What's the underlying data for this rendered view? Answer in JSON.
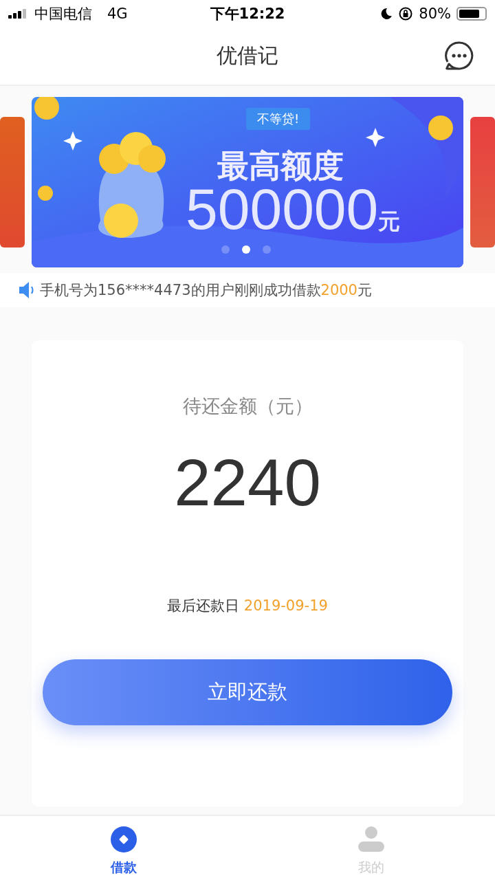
{
  "status_bar": {
    "carrier": "中国电信",
    "network": "4G",
    "time": "下午12:22",
    "battery": "80%"
  },
  "nav": {
    "title": "优借记"
  },
  "banner": {
    "tag": "不等贷!",
    "headline": "最高额度",
    "amount": "500000",
    "unit": "元",
    "dots": [
      {
        "selected": false
      },
      {
        "selected": true
      },
      {
        "selected": false
      }
    ]
  },
  "notice": {
    "text": "手机号为156****4473的用户刚刚成功借款",
    "amount": "2000",
    "unit": "元"
  },
  "repayment": {
    "label": "待还金额（元）",
    "amount": "2240",
    "due_label": "最后还款日",
    "due_date": "2019-09-19",
    "button": "立即还款"
  },
  "tab_bar": [
    {
      "label": "借款",
      "kind": "loan",
      "selected": true
    },
    {
      "label": "我的",
      "kind": "profile",
      "selected": false
    }
  ]
}
